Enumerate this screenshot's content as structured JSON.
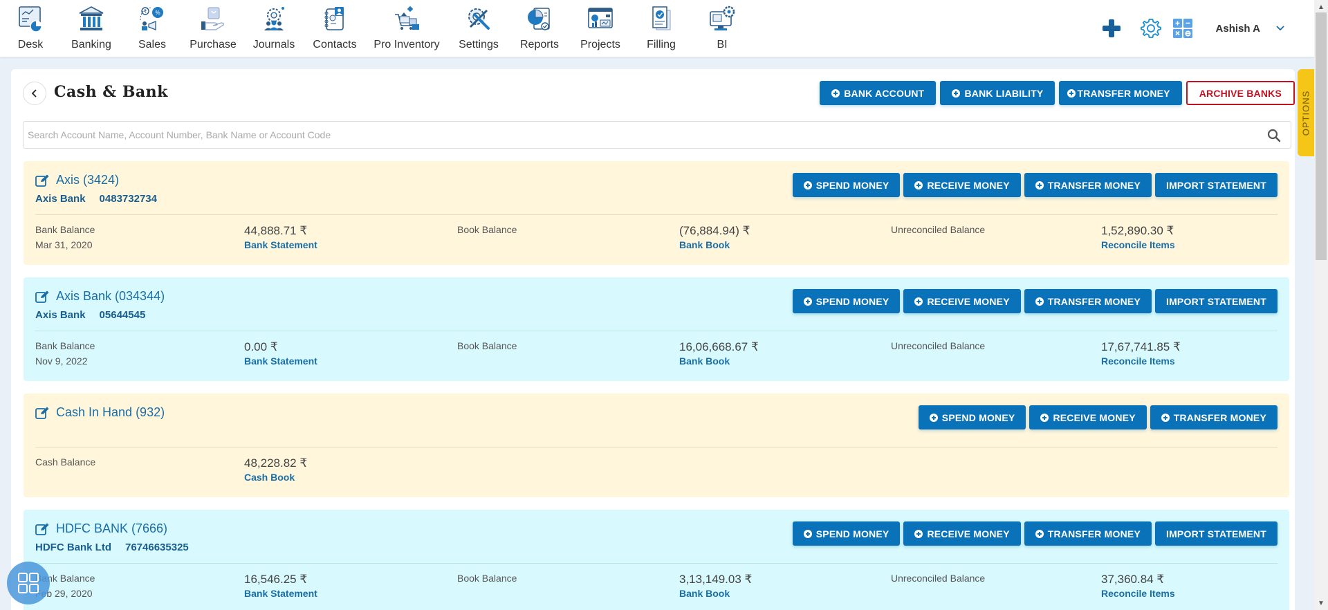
{
  "nav": {
    "items": [
      {
        "label": "Desk",
        "icon": "desk-icon"
      },
      {
        "label": "Banking",
        "icon": "bank-icon"
      },
      {
        "label": "Sales",
        "icon": "sales-icon"
      },
      {
        "label": "Purchase",
        "icon": "purchase-icon"
      },
      {
        "label": "Journals",
        "icon": "journals-icon"
      },
      {
        "label": "Contacts",
        "icon": "contacts-icon"
      },
      {
        "label": "Pro Inventory",
        "icon": "inventory-icon"
      },
      {
        "label": "Settings",
        "icon": "settings-icon"
      },
      {
        "label": "Reports",
        "icon": "reports-icon"
      },
      {
        "label": "Projects",
        "icon": "projects-icon"
      },
      {
        "label": "Filling",
        "icon": "filling-icon"
      },
      {
        "label": "BI",
        "icon": "bi-icon"
      }
    ],
    "user_name": "Ashish A"
  },
  "options_tab": "OPTIONS",
  "page": {
    "title": "Cash & Bank",
    "actions": {
      "bank_account": "BANK ACCOUNT",
      "bank_liability": "BANK LIABILITY",
      "transfer_money": "TRANSFER MONEY",
      "archive_banks": "ARCHIVE BANKS"
    },
    "search_placeholder": "Search Account Name, Account Number, Bank Name or Account Code",
    "search_value": ""
  },
  "card_buttons": {
    "spend": "SPEND MONEY",
    "receive": "RECEIVE MONEY",
    "transfer": "TRANSFER MONEY",
    "import": "IMPORT STATEMENT"
  },
  "colors": {
    "primary": "#0a72b8",
    "danger": "#c1121f",
    "card_yellow": "#fff6dc",
    "card_cyan": "#d8fafe",
    "options_tab": "#f5c518"
  },
  "accounts": [
    {
      "title": "Axis (3424)",
      "bank_name": "Axis Bank",
      "account_number": "0483732734",
      "bank_balance_label": "Bank Balance",
      "bank_balance_date": "Mar 31, 2020",
      "bank_balance": "44,888.71 ₹",
      "bank_statement_link": "Bank Statement",
      "book_balance_label": "Book Balance",
      "book_balance": "(76,884.94) ₹",
      "bank_book_link": "Bank Book",
      "unreconciled_label": "Unreconciled Balance",
      "unreconciled_balance": "1,52,890.30 ₹",
      "reconcile_link": "Reconcile Items"
    },
    {
      "title": "Axis Bank (034344)",
      "bank_name": "Axis Bank",
      "account_number": "05644545",
      "bank_balance_label": "Bank Balance",
      "bank_balance_date": "Nov 9, 2022",
      "bank_balance": "0.00 ₹",
      "bank_statement_link": "Bank Statement",
      "book_balance_label": "Book Balance",
      "book_balance": "16,06,668.67 ₹",
      "bank_book_link": "Bank Book",
      "unreconciled_label": "Unreconciled Balance",
      "unreconciled_balance": "17,67,741.85 ₹",
      "reconcile_link": "Reconcile Items"
    },
    {
      "title": "Cash In Hand (932)",
      "cash_balance_label": "Cash Balance",
      "cash_balance": "48,228.82 ₹",
      "cash_book_link": "Cash Book"
    },
    {
      "title": "HDFC BANK (7666)",
      "bank_name": "HDFC Bank Ltd",
      "account_number": "76746635325",
      "bank_balance_label": "Bank Balance",
      "bank_balance_date": "Feb 29, 2020",
      "bank_balance": "16,546.25 ₹",
      "bank_statement_link": "Bank Statement",
      "book_balance_label": "Book Balance",
      "book_balance": "3,13,149.03 ₹",
      "bank_book_link": "Bank Book",
      "unreconciled_label": "Unreconciled Balance",
      "unreconciled_balance": "37,360.84 ₹",
      "reconcile_link": "Reconcile Items"
    }
  ]
}
